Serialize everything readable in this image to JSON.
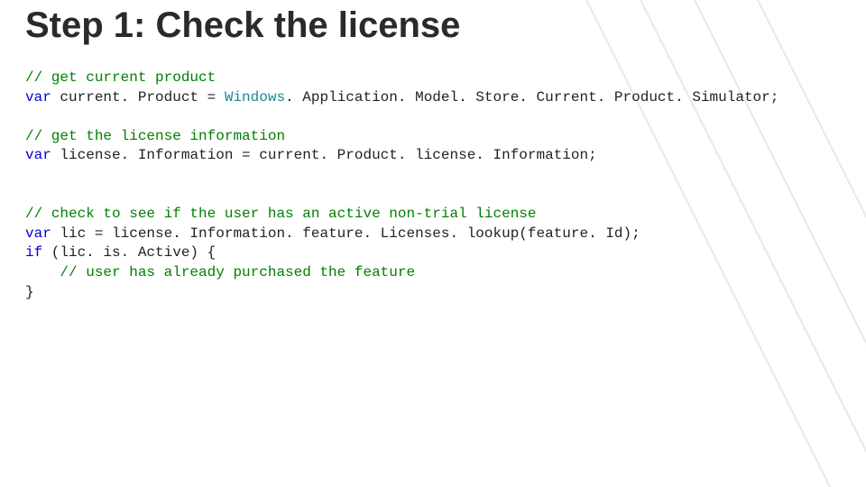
{
  "title": "Step 1: Check the license",
  "code": {
    "c1": "// get current product",
    "l1_kw": "var",
    "l1_id": " current. Product = ",
    "l1_ty": "Windows",
    "l1_r": ". Application. Model. Store. Current. Product. Simulator;",
    "c2": "// get the license information",
    "l2_kw": "var",
    "l2_id": " license. Information = current. Product. license. Information;",
    "c3": "// check to see if the user has an active non-trial license",
    "l3_kw": "var",
    "l3_id": " lic = license. Information. feature. Licenses. lookup(feature. Id);",
    "l4_kw": "if",
    "l4_r": " (lic. is. Active) {",
    "c4": "    // user has already purchased the feature",
    "l5": "}"
  }
}
